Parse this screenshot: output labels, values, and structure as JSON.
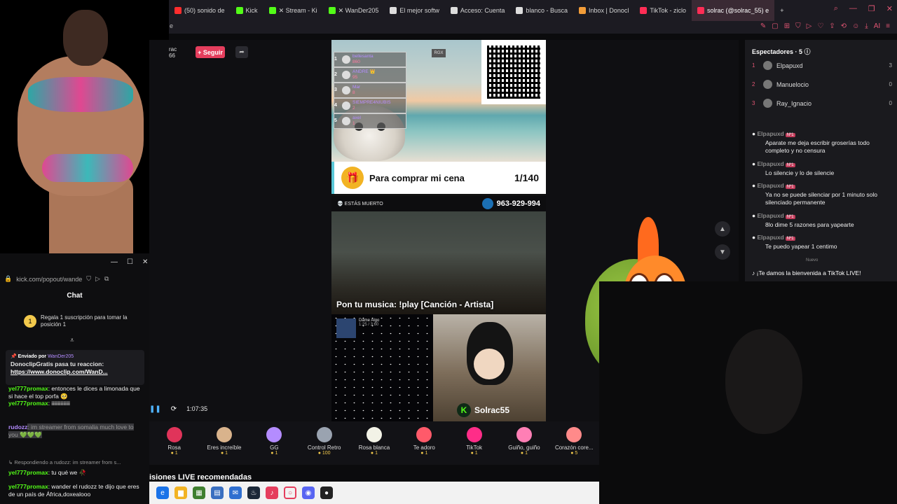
{
  "browser": {
    "tabs": [
      {
        "label": "(50) sonido de",
        "color": "#ff2d2d"
      },
      {
        "label": "Kick",
        "color": "#53fc18"
      },
      {
        "label": "✕ Stream - Ki",
        "color": "#53fc18"
      },
      {
        "label": "✕ WanDer205",
        "color": "#53fc18"
      },
      {
        "label": "El mejor softw",
        "color": "#dddddd"
      },
      {
        "label": "Acceso: Cuenta",
        "color": "#dddddd"
      },
      {
        "label": "blanco - Busca",
        "color": "#dddddd"
      },
      {
        "label": "Inbox | Donocl",
        "color": "#f29c38"
      },
      {
        "label": "TikTok - ziclo",
        "color": "#ff2d55"
      },
      {
        "label": "solrac (@solrac_55) e",
        "color": "#ff2d55",
        "active": true
      }
    ],
    "new_tab": "+",
    "toolbar_letter": "e",
    "ai_label": "AI"
  },
  "stream": {
    "streamer_short": "rac",
    "streamer_count": "66",
    "follow_label": "+ Seguir",
    "leaderboard": [
      {
        "rank": "1",
        "name": "bellesanta",
        "points": "860"
      },
      {
        "rank": "2",
        "name": "ANDRE 👑",
        "points": "95"
      },
      {
        "rank": "3",
        "name": "Mar",
        "points": "8"
      },
      {
        "rank": "4",
        "name": "SIEMPRE4NIUBIS",
        "points": "2"
      },
      {
        "rank": "5",
        "name": "axel",
        "points": "1"
      }
    ],
    "rgx": "RGX",
    "goal_title": "Para comprar mi cena",
    "goal_count": "1/140",
    "game_status": "💀 ESTÁS MUERTO",
    "steam_code": "963-929-994",
    "music_text": "Pon tu musica: !play [Canción - Artista]",
    "track_name": "Dame Algo",
    "track_time": "1:25 / 3:60",
    "channel_name": "Solrac55",
    "player_time": "1:07:35"
  },
  "gifts": [
    {
      "name": "Rosa",
      "price": "1",
      "color": "#e0345a"
    },
    {
      "name": "Eres increíble",
      "price": "1",
      "color": "#d9b38c"
    },
    {
      "name": "GG",
      "price": "1",
      "color": "#b48cff"
    },
    {
      "name": "Control Retro",
      "price": "100",
      "color": "#9aa3b0"
    },
    {
      "name": "Rosa blanca",
      "price": "1",
      "color": "#f2f2e6"
    },
    {
      "name": "Te adoro",
      "price": "1",
      "color": "#ff5a6a"
    },
    {
      "name": "TikTok",
      "price": "1",
      "color": "#ff2d88"
    },
    {
      "name": "Guiño, guiño",
      "price": "1",
      "color": "#ff7fb5"
    },
    {
      "name": "Corazón core...",
      "price": "5",
      "color": "#ff8a8a"
    }
  ],
  "recommended": "isiones LIVE recomendadas",
  "viewers": {
    "title": "Espectadores · 5",
    "list": [
      {
        "rank": "1",
        "name": "Elpapuxd",
        "score": "3"
      },
      {
        "rank": "2",
        "name": "Manuelocio",
        "score": "0"
      },
      {
        "rank": "3",
        "name": "Ray_Ignacio",
        "score": "0"
      }
    ]
  },
  "tiktok_chat": [
    {
      "user": "Elpapuxd",
      "badge": "Nº1",
      "text": "Aparate me deja escribir groserías todo completo y no censura"
    },
    {
      "user": "Elpapuxd",
      "badge": "Nº1",
      "text": "Lo silencie y lo de silencie"
    },
    {
      "user": "Elpapuxd",
      "badge": "Nº1",
      "text": "Ya no se puede silenciar por 1 minuto solo silenciado permanente"
    },
    {
      "user": "Elpapuxd",
      "badge": "Nº1",
      "text": "8lo dime 5 razones para yapearte"
    },
    {
      "user": "Elpapuxd",
      "badge": "Nº1",
      "text": "Te puedo yapear 1 centimo"
    }
  ],
  "nuevo": "Nuevo",
  "welcome": "¡Te damos la bienvenida a TikTok LIVE!",
  "kick_popout": {
    "url": "kick.com/popout/wande",
    "title": "Chat",
    "sub_rank": "1",
    "sub_note": "Regala 1 suscripción para tomar la posición 1",
    "pinned_by": "Enviado por",
    "pinned_user": "WanDer205",
    "pinned_text": "DonoclipGratis pasa tu reaccion:",
    "pinned_link": "https://www.donoclip.com/WanD...",
    "messages": [
      {
        "user": "yel777promax",
        "text": ": entonces le dices a limonada que si hace el top porfa 🥺"
      },
      {
        "user": "yel777promax",
        "text": ": iiiiiiiiiiiiii"
      },
      {
        "user": "rudozz",
        "text": ": im streamer from somalia much love to you 💚💚💚"
      },
      {
        "user": "yel777promax",
        "text": ": tu qué we 🥀"
      },
      {
        "user": "yel777promax",
        "text": ": wander el rudozz te dijo que eres de un país de África,doxealooo"
      }
    ],
    "reply_note": "↳ Respondiendo a rudozz: im streamer from s..."
  }
}
